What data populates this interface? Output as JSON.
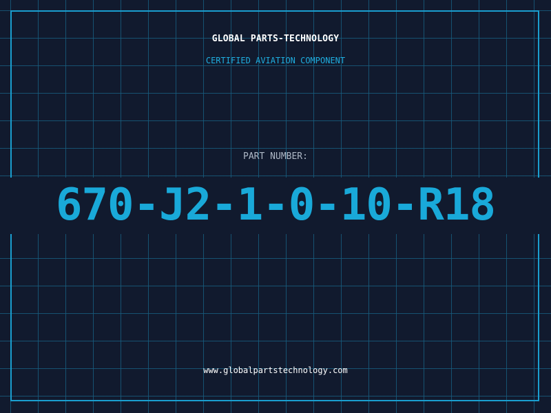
{
  "header": {
    "company": "GLOBAL PARTS-TECHNOLOGY",
    "subtitle": "CERTIFIED AVIATION COMPONENT"
  },
  "part": {
    "label": "PART NUMBER:",
    "number": "670-J2-1-0-10-R18"
  },
  "footer": {
    "url": "www.globalpartstechnology.com"
  },
  "colors": {
    "background": "#111a2e",
    "grid": "#175c7d",
    "accent": "#1a9fd0",
    "text": "#ffffff"
  }
}
